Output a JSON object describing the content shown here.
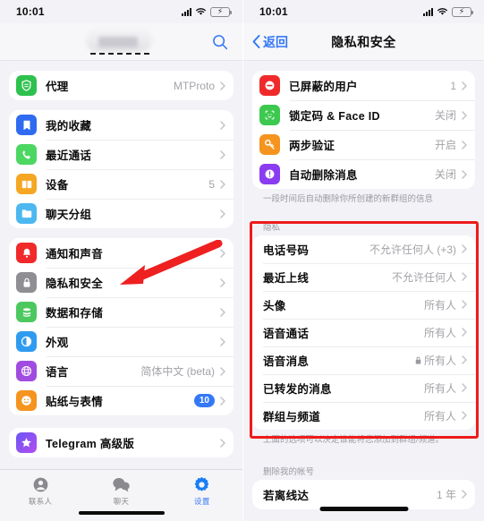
{
  "left": {
    "status": {
      "time": "10:01",
      "signal_icon": "cellular-signal-icon",
      "wifi_icon": "wifi-icon",
      "battery_icon": "battery-charging-icon"
    },
    "header": {
      "search_icon": "search-icon",
      "redacted_title": ""
    },
    "groups": [
      {
        "id": "proxy",
        "rows": [
          {
            "label": "代理",
            "value": "MTProto",
            "icon": "proxy-shield-icon",
            "color": "#2ec14e"
          }
        ]
      },
      {
        "id": "personal",
        "rows": [
          {
            "label": "我的收藏",
            "value": "",
            "icon": "bookmark-icon",
            "color": "#2f6bf0"
          },
          {
            "label": "最近通话",
            "value": "",
            "icon": "phone-icon",
            "color": "#4cd662"
          },
          {
            "label": "设备",
            "value": "5",
            "icon": "devices-icon",
            "color": "#f5a623"
          },
          {
            "label": "聊天分组",
            "value": "",
            "icon": "folder-icon",
            "color": "#4db8f0"
          }
        ]
      },
      {
        "id": "settings",
        "rows": [
          {
            "label": "通知和声音",
            "value": "",
            "icon": "bell-icon",
            "color": "#f02a2a"
          },
          {
            "label": "隐私和安全",
            "value": "",
            "icon": "lock-icon",
            "color": "#8e8e93"
          },
          {
            "label": "数据和存储",
            "value": "",
            "icon": "database-icon",
            "color": "#4cc85f"
          },
          {
            "label": "外观",
            "value": "",
            "icon": "appearance-contrast-icon",
            "color": "#2f9bf0"
          },
          {
            "label": "语言",
            "value": "简体中文 (beta)",
            "icon": "globe-icon",
            "color": "#a košice"
          },
          {
            "label": "贴纸与表情",
            "value": "",
            "badge": "10",
            "icon": "sticker-icon",
            "color": "#f5941f"
          }
        ]
      },
      {
        "id": "premium",
        "rows": [
          {
            "label": "Telegram 高级版",
            "value": "",
            "icon": "premium-star-icon",
            "color": "#7b4ff0"
          }
        ]
      }
    ],
    "tabs": [
      {
        "label": "联系人",
        "icon": "contacts-icon",
        "active": false
      },
      {
        "label": "聊天",
        "icon": "chats-icon",
        "active": false
      },
      {
        "label": "设置",
        "icon": "settings-gear-icon",
        "active": true
      }
    ]
  },
  "right": {
    "status": {
      "time": "10:01",
      "signal_icon": "cellular-signal-icon",
      "wifi_icon": "wifi-icon",
      "battery_icon": "battery-charging-icon"
    },
    "nav": {
      "back_label": "返回",
      "back_icon": "chevron-left-icon",
      "title": "隐私和安全"
    },
    "security_group": {
      "rows": [
        {
          "label": "已屏蔽的用户",
          "value": "1",
          "icon": "block-user-icon",
          "color": "#f02a2a"
        },
        {
          "label": "锁定码 & Face ID",
          "value": "关闭",
          "icon": "face-id-icon",
          "color": "#3dc94f"
        },
        {
          "label": "两步验证",
          "value": "开启",
          "icon": "key-icon",
          "color": "#f5941f"
        },
        {
          "label": "自动删除消息",
          "value": "关闭",
          "icon": "auto-delete-timer-icon",
          "color": "#8a3df0"
        }
      ],
      "footnote": "一段时间后自动删除你所创建的新群组的信息"
    },
    "privacy_group": {
      "header": "隐私",
      "rows": [
        {
          "label": "电话号码",
          "value": "不允许任何人 (+3)",
          "locked": false
        },
        {
          "label": "最近上线",
          "value": "不允许任何人",
          "locked": false
        },
        {
          "label": "头像",
          "value": "所有人",
          "locked": false
        },
        {
          "label": "语音通话",
          "value": "所有人",
          "locked": false
        },
        {
          "label": "语音消息",
          "value": "所有人",
          "locked": true
        },
        {
          "label": "已转发的消息",
          "value": "所有人",
          "locked": false
        },
        {
          "label": "群组与频道",
          "value": "所有人",
          "locked": false
        }
      ],
      "footnote": "上面的选项可以决定谁能将您添加到群组/频道。"
    },
    "delete_group": {
      "header": "删除我的帐号",
      "rows": [
        {
          "label": "若离线达",
          "value": "1 年"
        }
      ]
    }
  },
  "annotations": {
    "box_color": "#ef1b1b",
    "arrow_color": "#ee2020",
    "arrow_target": "隐私和安全",
    "box_target": "隐私"
  }
}
